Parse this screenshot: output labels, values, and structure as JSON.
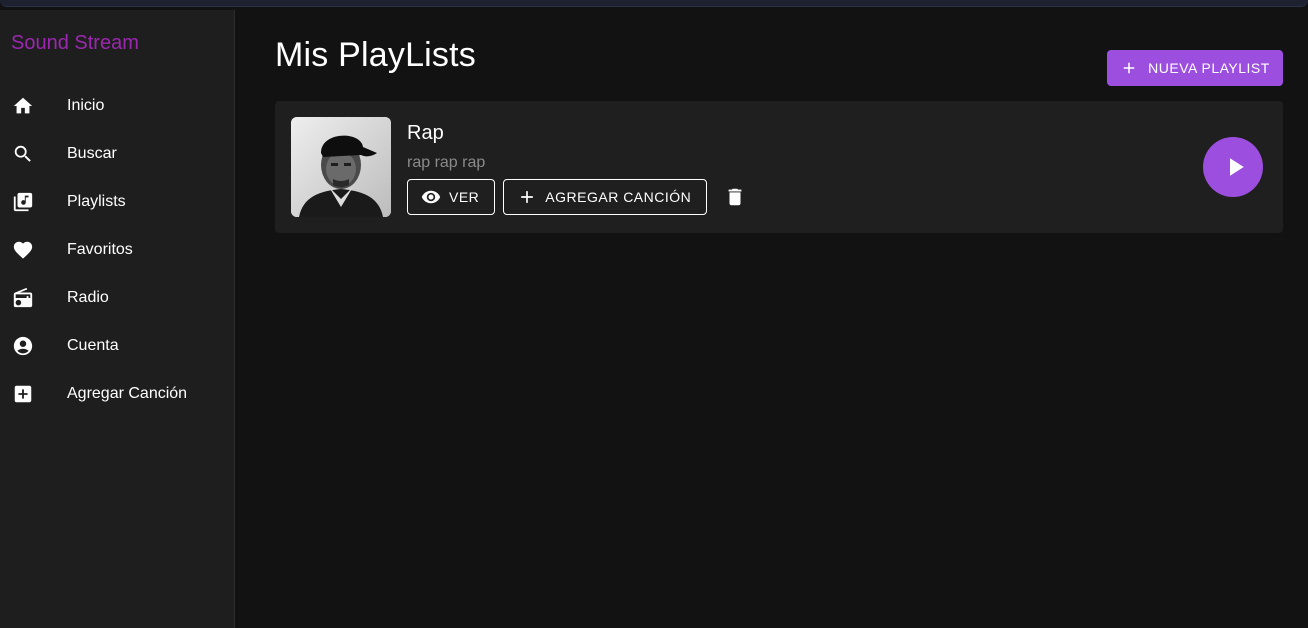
{
  "app": {
    "brand": "Sound Stream"
  },
  "sidebar": {
    "items": [
      {
        "label": "Inicio",
        "icon": "home-icon"
      },
      {
        "label": "Buscar",
        "icon": "search-icon"
      },
      {
        "label": "Playlists",
        "icon": "library-music-icon"
      },
      {
        "label": "Favoritos",
        "icon": "heart-icon"
      },
      {
        "label": "Radio",
        "icon": "radio-icon"
      },
      {
        "label": "Cuenta",
        "icon": "account-circle-icon"
      },
      {
        "label": "Agregar Canción",
        "icon": "add-box-icon"
      }
    ]
  },
  "main": {
    "title": "Mis PlayLists",
    "new_button_label": "NUEVA PLAYLIST",
    "playlists": [
      {
        "name": "Rap",
        "description": "rap rap rap",
        "view_label": "VER",
        "add_song_label": "AGREGAR CANCIÓN"
      }
    ]
  },
  "colors": {
    "accent": "#9c4fde",
    "brand": "#9c27b0",
    "sidebar_bg": "#1e1e1e",
    "page_bg": "#121212",
    "card_bg": "#1f1f1f"
  }
}
